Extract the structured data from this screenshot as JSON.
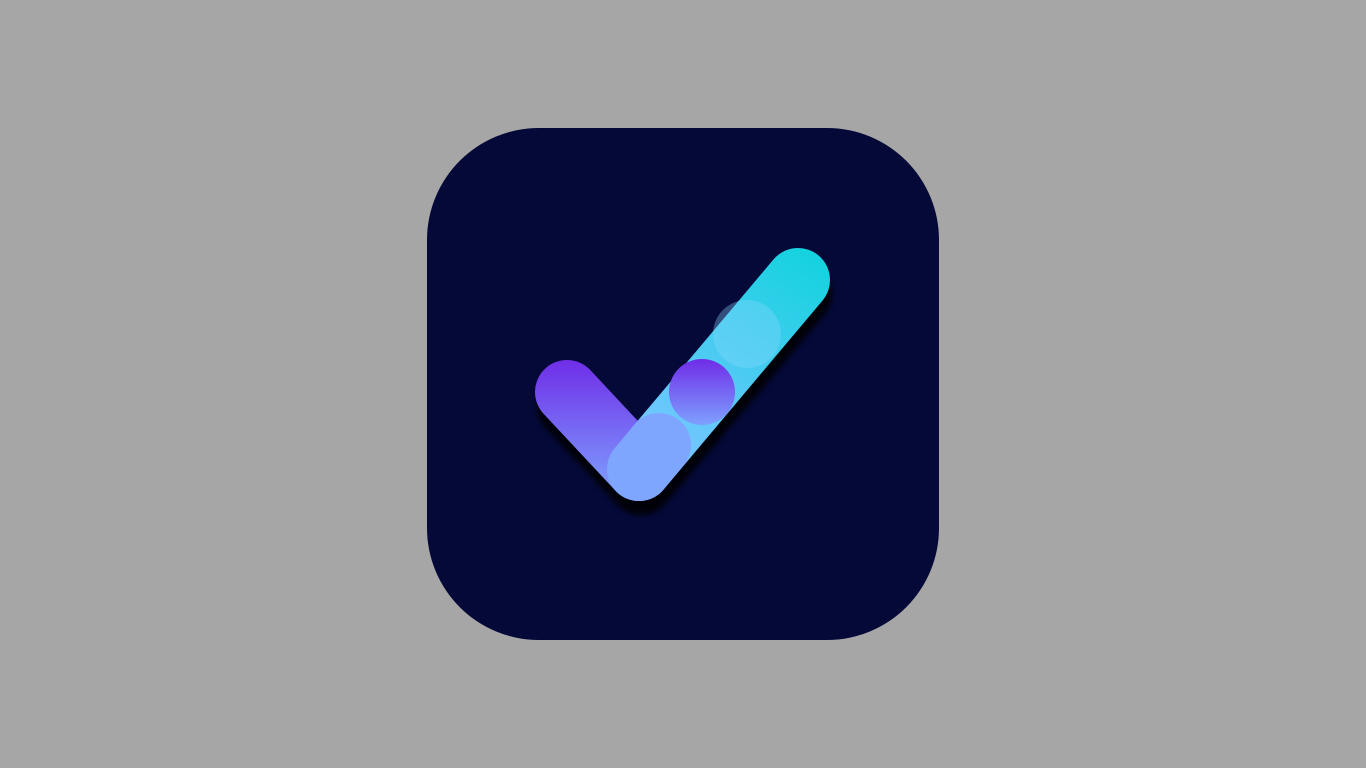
{
  "screen": {
    "background_color": "#a6a6a6"
  },
  "app_icon": {
    "icon": "checkmark-icon",
    "tile_color": "#050938",
    "gradient_colors": {
      "purple": "#6f2ee8",
      "periwinkle": "#7fa6ff",
      "sky": "#74c6ff",
      "cyan": "#0fd3de",
      "shadow": "#000000"
    }
  }
}
